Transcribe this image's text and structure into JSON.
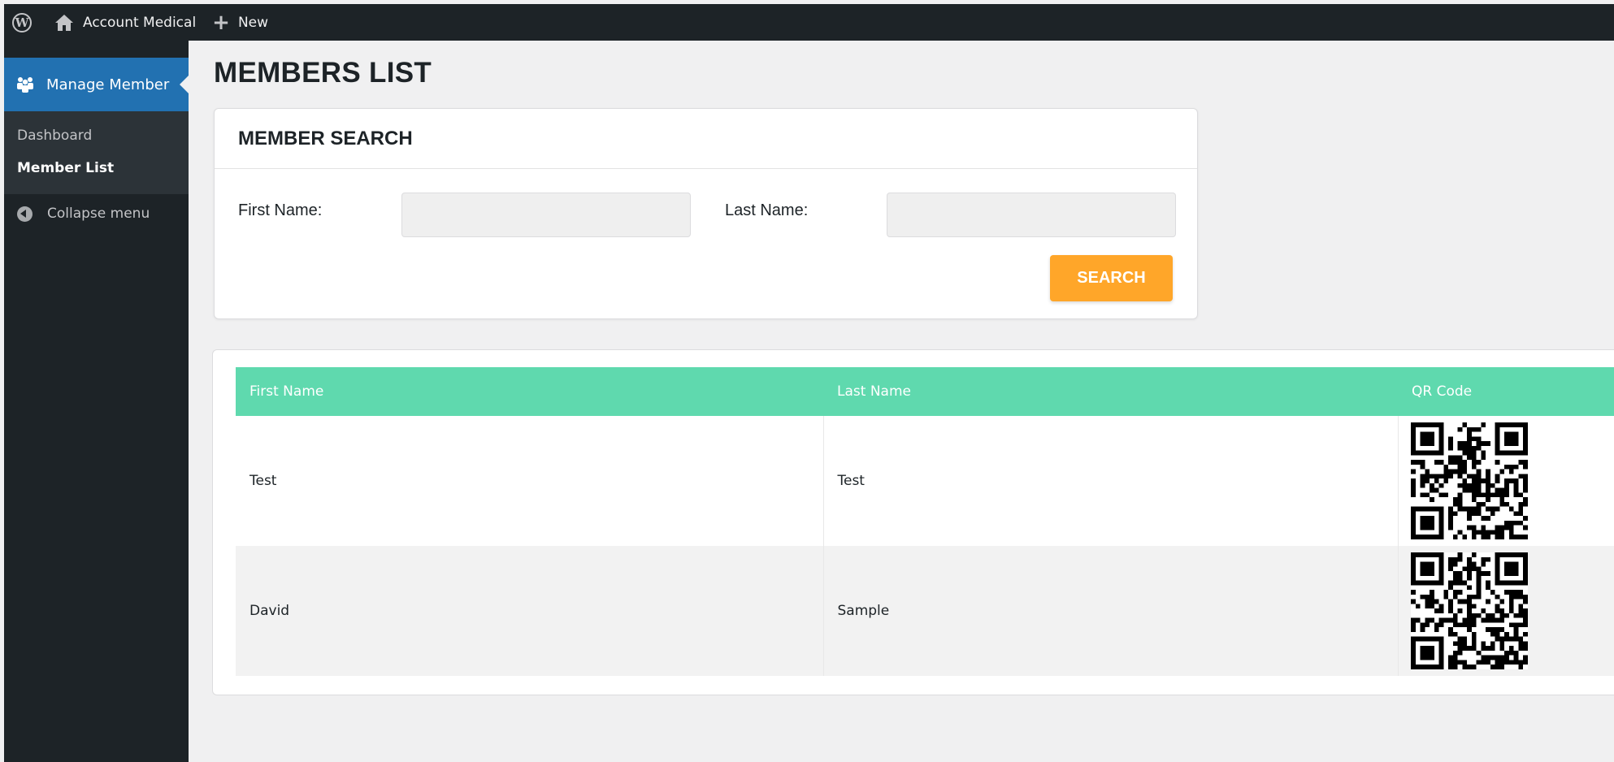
{
  "adminbar": {
    "site_name": "Account Medical",
    "new_label": "New"
  },
  "menu": {
    "top_item": "Manage Member",
    "submenu": [
      "Dashboard",
      "Member List"
    ],
    "collapse": "Collapse menu"
  },
  "page": {
    "title": "MEMBERS LIST"
  },
  "search": {
    "heading": "MEMBER SEARCH",
    "first_name_label": "First Name:",
    "first_name_value": "",
    "last_name_label": "Last Name:",
    "last_name_value": "",
    "button_label": "SEARCH"
  },
  "table": {
    "columns": [
      "First Name",
      "Last Name",
      "QR Code"
    ],
    "rows": [
      {
        "first": "Test",
        "last": "Test"
      },
      {
        "first": "David",
        "last": "Sample"
      }
    ]
  },
  "colors": {
    "adminbar_bg": "#1d2327",
    "menu_active": "#2271b1",
    "table_header": "#5fd9ae",
    "search_button": "#ffa629"
  },
  "icons": [
    "wordpress-logo-icon",
    "home-icon",
    "plus-icon",
    "people-icon",
    "collapse-arrow-icon",
    "qr-code-icon"
  ]
}
